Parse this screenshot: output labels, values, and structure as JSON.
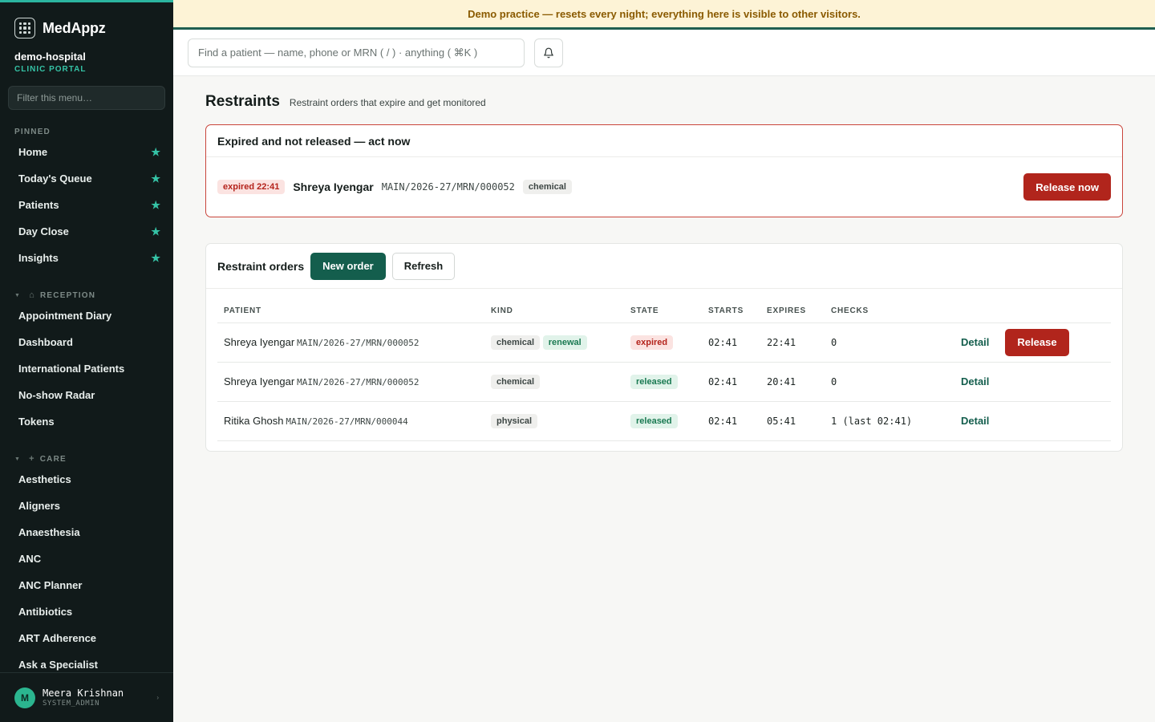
{
  "app": {
    "name": "MedAppz",
    "org": "demo-hospital",
    "portal": "CLINIC PORTAL"
  },
  "banner": "Demo practice — resets every night; everything here is visible to other visitors.",
  "sidebar": {
    "filter_placeholder": "Filter this menu…",
    "pinned_label": "PINNED",
    "pinned": [
      {
        "label": "Home"
      },
      {
        "label": "Today's Queue"
      },
      {
        "label": "Patients"
      },
      {
        "label": "Day Close"
      },
      {
        "label": "Insights"
      }
    ],
    "reception_label": "RECEPTION",
    "reception": [
      {
        "label": "Appointment Diary"
      },
      {
        "label": "Dashboard"
      },
      {
        "label": "International Patients"
      },
      {
        "label": "No-show Radar"
      },
      {
        "label": "Tokens"
      }
    ],
    "care_label": "CARE",
    "care": [
      {
        "label": "Aesthetics"
      },
      {
        "label": "Aligners"
      },
      {
        "label": "Anaesthesia"
      },
      {
        "label": "ANC"
      },
      {
        "label": "ANC Planner"
      },
      {
        "label": "Antibiotics"
      },
      {
        "label": "ART Adherence"
      },
      {
        "label": "Ask a Specialist"
      }
    ],
    "user": {
      "initial": "M",
      "name": "Meera Krishnan",
      "role": "SYSTEM_ADMIN"
    }
  },
  "topbar": {
    "search_placeholder": "Find a patient — name, phone or MRN ( / ) · anything ( ⌘K )"
  },
  "page": {
    "title": "Restraints",
    "subtitle": "Restraint orders that expire and get monitored"
  },
  "alert": {
    "title": "Expired and not released — act now",
    "badge": "expired 22:41",
    "patient": "Shreya Iyengar",
    "mrn": "MAIN/2026-27/MRN/000052",
    "kind": "chemical",
    "action": "Release now"
  },
  "orders": {
    "title": "Restraint orders",
    "new_label": "New order",
    "refresh_label": "Refresh",
    "columns": {
      "patient": "PATIENT",
      "kind": "KIND",
      "state": "STATE",
      "starts": "STARTS",
      "expires": "EXPIRES",
      "checks": "CHECKS"
    },
    "detail_label": "Detail",
    "release_label": "Release",
    "rows": [
      {
        "name": "Shreya Iyengar",
        "mrn": "MAIN/2026-27/MRN/000052",
        "kind": "chemical",
        "extra": "renewal",
        "state": "expired",
        "starts": "02:41",
        "expires": "22:41",
        "checks": "0"
      },
      {
        "name": "Shreya Iyengar",
        "mrn": "MAIN/2026-27/MRN/000052",
        "kind": "chemical",
        "state": "released",
        "starts": "02:41",
        "expires": "20:41",
        "checks": "0"
      },
      {
        "name": "Ritika Ghosh",
        "mrn": "MAIN/2026-27/MRN/000044",
        "kind": "physical",
        "state": "released",
        "starts": "02:41",
        "expires": "05:41",
        "checks": "1 (last 02:41)"
      }
    ]
  },
  "colors": {
    "accent": "#145e4d",
    "danger": "#b1251c",
    "sidebar_bg": "#111a1a",
    "banner_bg": "#fdf3d6"
  }
}
